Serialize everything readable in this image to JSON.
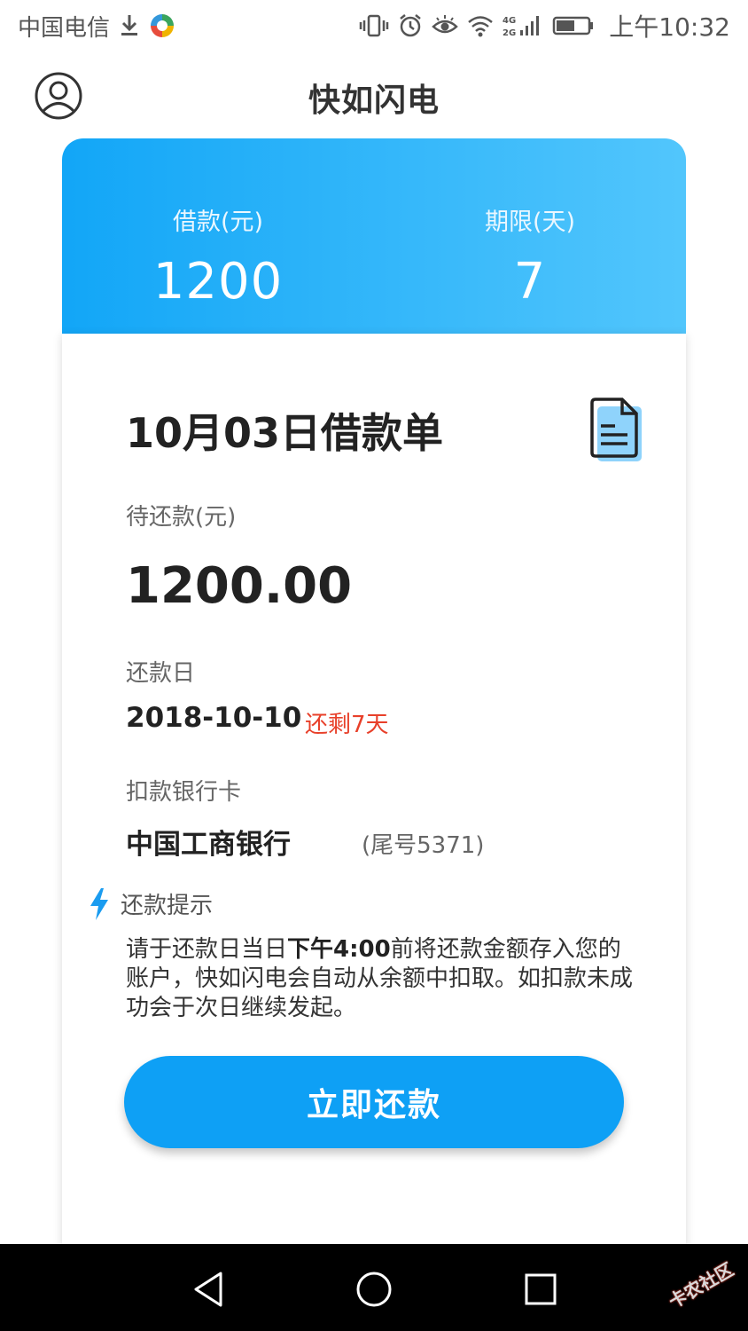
{
  "status_bar": {
    "carrier": "中国电信",
    "network_label": "4G 2G",
    "time": "上午10:32"
  },
  "header": {
    "title": "快如闪电"
  },
  "summary": {
    "loan_label": "借款(元)",
    "loan_value": "1200",
    "term_label": "期限(天)",
    "term_value": "7"
  },
  "bill": {
    "title": "10月03日借款单",
    "amount_label": "待还款(元)",
    "amount_value": "1200.00",
    "due_date_label": "还款日",
    "due_date_value": "2018-10-10",
    "days_left": "还剩7天",
    "bank_label": "扣款银行卡",
    "bank_name": "中国工商银行",
    "card_tail": "(尾号5371)"
  },
  "tip": {
    "title": "还款提示",
    "text_before": "请于还款日当日",
    "text_bold": "下午4:00",
    "text_after": "前将还款金额存入您的账户，快如闪电会自动从余额中扣取。如扣款未成功会于次日继续发起。"
  },
  "actions": {
    "repay_label": "立即还款"
  },
  "watermark": "卡农社区",
  "colors": {
    "primary": "#0ea0f5",
    "gradient_start": "#12a6f7",
    "gradient_end": "#52c6fc",
    "alert": "#e8402a"
  },
  "icons": {
    "avatar": "user-circle-icon",
    "document": "document-icon",
    "tip": "lightning-icon",
    "nav_back": "triangle-back-icon",
    "nav_home": "circle-home-icon",
    "nav_recent": "square-recent-icon"
  }
}
